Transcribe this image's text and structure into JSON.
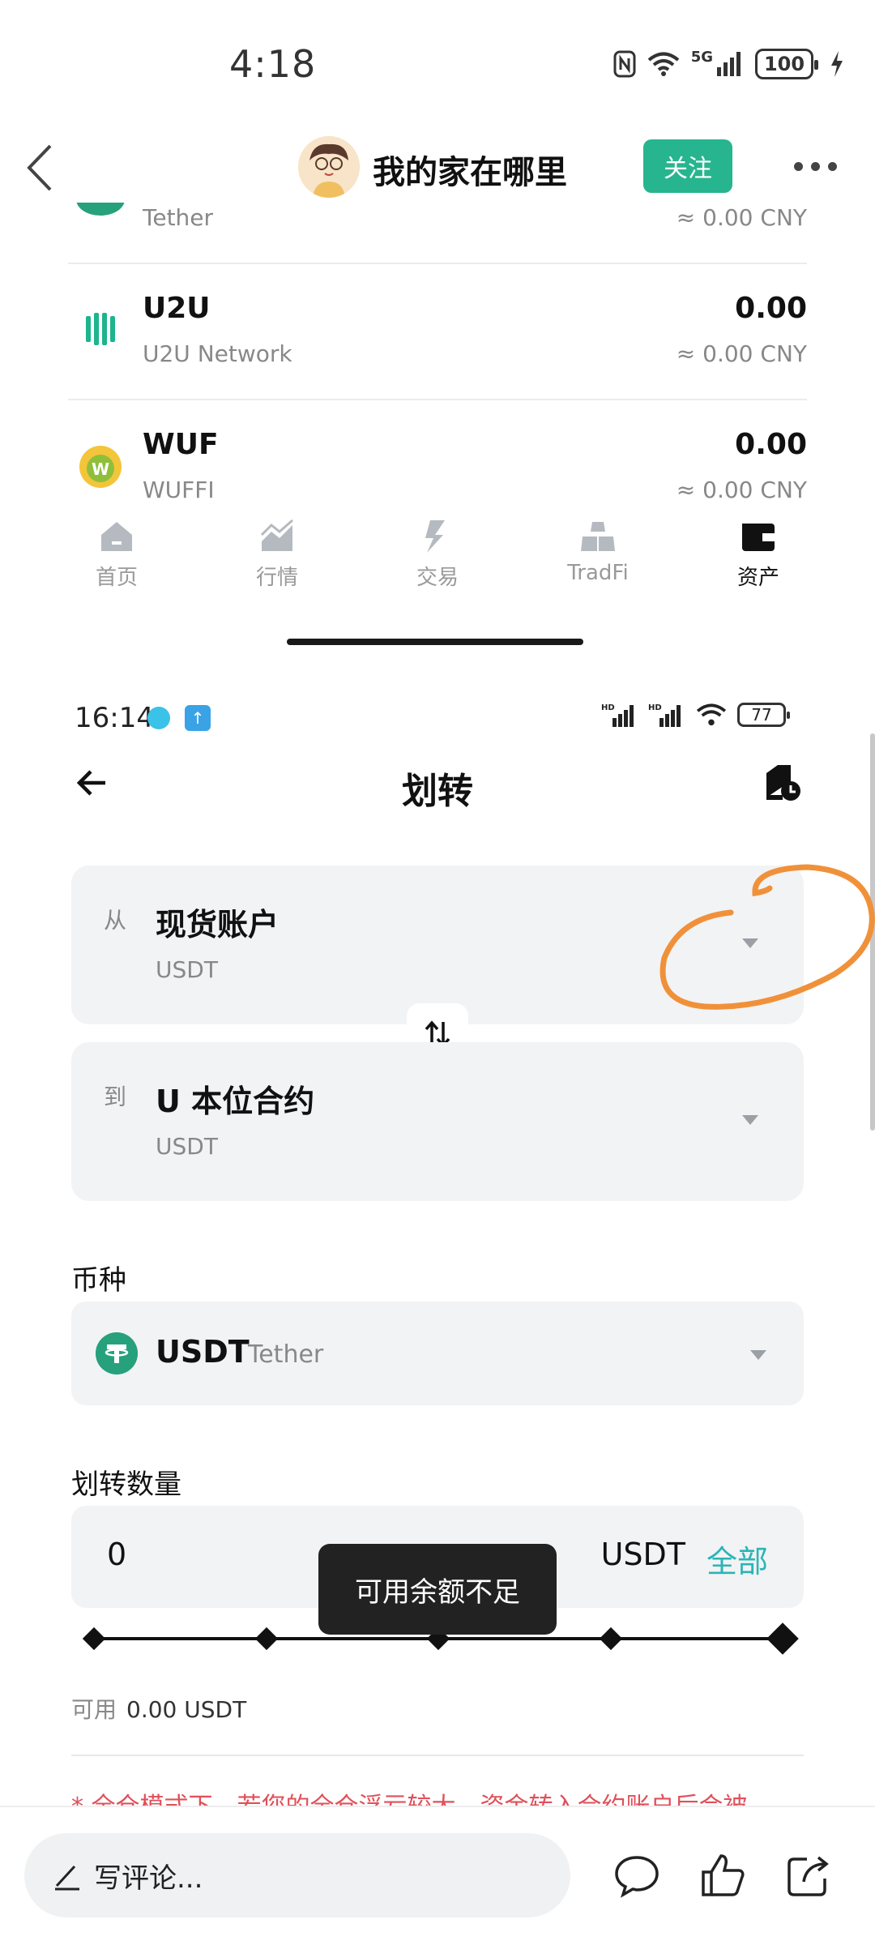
{
  "outer_status": {
    "time": "4:18",
    "network": "5G",
    "battery": "100"
  },
  "outer_header": {
    "title": "我的家在哪里",
    "follow_label": "关注"
  },
  "assets": [
    {
      "symbol": "",
      "name": "Tether",
      "amount": "",
      "cny": "≈ 0.00 CNY"
    },
    {
      "symbol": "U2U",
      "name": "U2U Network",
      "amount": "0.00",
      "cny": "≈ 0.00 CNY"
    },
    {
      "symbol": "WUF",
      "name": "WUFFI",
      "amount": "0.00",
      "cny": "≈ 0.00 CNY"
    }
  ],
  "outer_nav": [
    {
      "label": "首页",
      "icon": "home-icon"
    },
    {
      "label": "行情",
      "icon": "market-chart-icon"
    },
    {
      "label": "交易",
      "icon": "trade-icon"
    },
    {
      "label": "TradFi",
      "icon": "tradfi-icon"
    },
    {
      "label": "资产",
      "icon": "wallet-icon",
      "active": true
    }
  ],
  "inner_status": {
    "time": "16:14",
    "battery": "77"
  },
  "inner_header": {
    "title": "划转"
  },
  "transfer": {
    "from": {
      "prefix": "从",
      "account": "现货账户",
      "currency": "USDT"
    },
    "to": {
      "prefix": "到",
      "account": "U 本位合约",
      "currency": "USDT"
    }
  },
  "currency_section": {
    "label": "币种",
    "symbol": "USDT",
    "full_name": "Tether"
  },
  "amount_section": {
    "label": "划转数量",
    "value": "0",
    "unit": "USDT",
    "all_label": "全部"
  },
  "slider": {
    "stops": [
      0,
      25,
      50,
      75,
      100
    ],
    "value": 0
  },
  "toast": {
    "text": "可用余额不足"
  },
  "available": {
    "label": "可用",
    "value": "0.00 USDT"
  },
  "warning": {
    "text": "* 全仓模式下，若您的全仓浮亏较大，资金转入合约账户后会被"
  },
  "comment_bar": {
    "placeholder": "写评论..."
  },
  "colors": {
    "accent": "#27b58f",
    "link": "#2bb5b5",
    "annotation": "#f0913a",
    "warning": "#e0505a"
  }
}
